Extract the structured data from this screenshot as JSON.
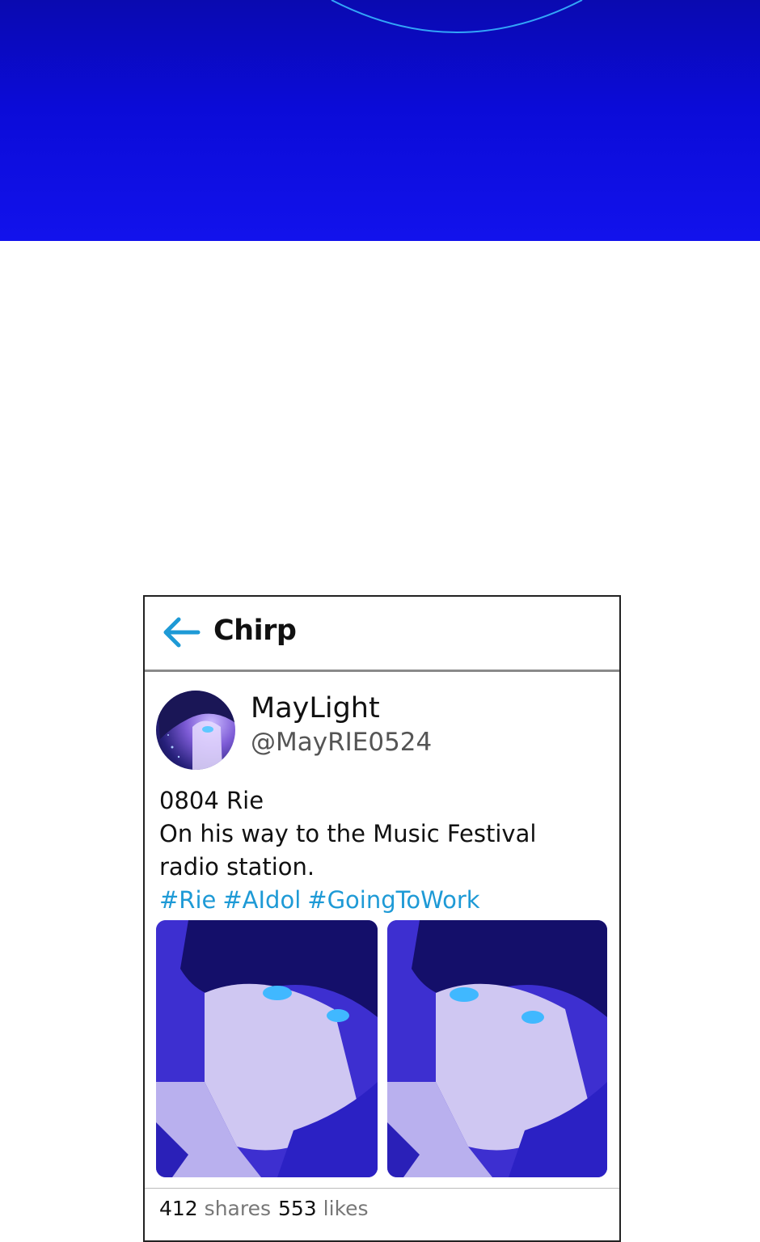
{
  "app": {
    "title": "Chirp"
  },
  "post": {
    "display_name": "MayLight",
    "handle": "@MayRIE0524",
    "lines": [
      "0804 Rie",
      "On his way to the Music Festival",
      "radio station."
    ],
    "hashtags": [
      "#Rie",
      "#AIdol",
      "#GoingToWork"
    ]
  },
  "stats": {
    "shares_count": "412",
    "shares_label": "shares",
    "likes_count": "553",
    "likes_label": "likes"
  },
  "colors": {
    "accent": "#1e9ad6",
    "top_panel": "#0b0bd8"
  },
  "icons": {
    "back": "arrow-left-icon"
  }
}
